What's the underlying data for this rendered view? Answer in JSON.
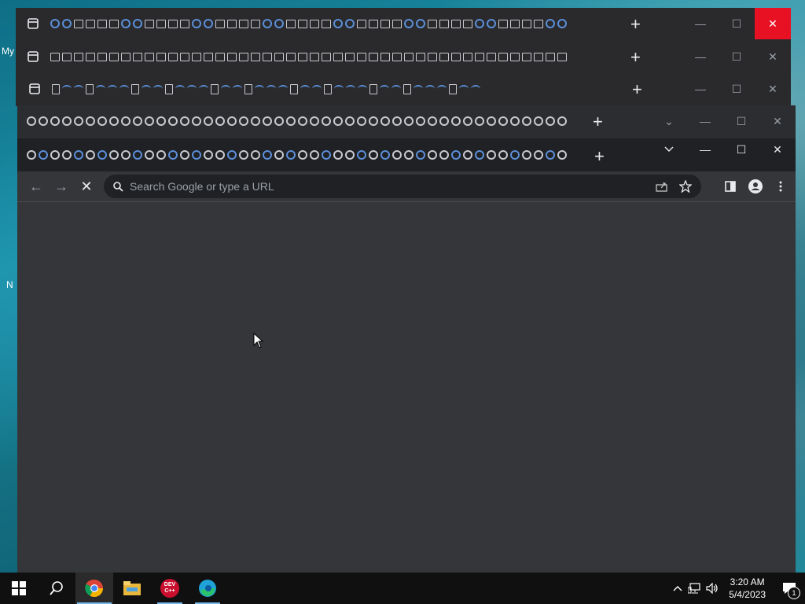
{
  "desktop": {
    "labels": [
      "My",
      "N"
    ]
  },
  "windows": [
    {
      "new_tab": "+",
      "controls": [
        "—",
        "☐",
        "✕"
      ],
      "icon_style": "box",
      "close_highlight": true
    },
    {
      "new_tab": "+",
      "controls": [
        "—",
        "☐",
        "✕"
      ],
      "icon_style": "box"
    },
    {
      "new_tab": "+",
      "controls": [
        "—",
        "☐",
        "✕"
      ],
      "icon_style": "doc"
    },
    {
      "new_tab": "+",
      "controls": [
        "⌄",
        "—",
        "☐",
        "✕"
      ],
      "icon_style": "chrome"
    }
  ],
  "browser": {
    "tab_search_icon": "chevron-down-icon",
    "new_tab_label": "+",
    "controls": {
      "minimize": "—",
      "maximize": "☐",
      "close": "✕"
    },
    "toolbar": {
      "back": "←",
      "forward": "→",
      "stop": "✕",
      "omnibox_placeholder": "Search Google or type a URL"
    }
  },
  "taskbar": {
    "clock_time": "3:20 AM",
    "clock_date": "5/4/2023",
    "notification_count": "1",
    "apps": [
      "start-icon",
      "search-icon",
      "chrome-icon",
      "file-explorer-icon",
      "dev-cpp-icon",
      "edge-icon"
    ],
    "devcpp_label": "DEV C++"
  }
}
